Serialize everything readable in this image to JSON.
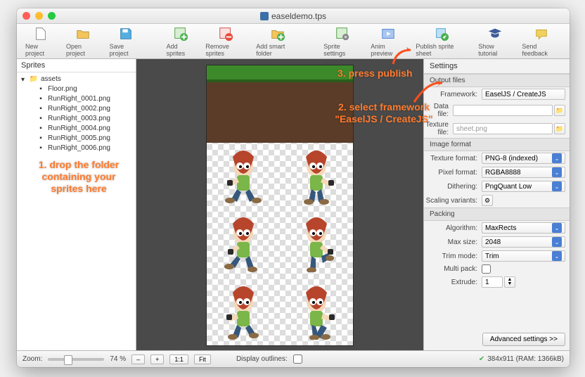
{
  "title": "easeldemo.tps",
  "toolbar": {
    "new": "New project",
    "open": "Open project",
    "save": "Save project",
    "addsprites": "Add sprites",
    "removesprites": "Remove sprites",
    "addsmart": "Add smart folder",
    "spritesettings": "Sprite settings",
    "animpreview": "Anim preview",
    "publish": "Publish sprite sheet",
    "tutorial": "Show tutorial",
    "feedback": "Send feedback"
  },
  "sidebar": {
    "heading": "Sprites",
    "folder": "assets",
    "files": [
      "Floor.png",
      "RunRight_0001.png",
      "RunRight_0002.png",
      "RunRight_0003.png",
      "RunRight_0004.png",
      "RunRight_0005.png",
      "RunRight_0006.png"
    ]
  },
  "props": {
    "heading": "Settings",
    "output": {
      "section": "Output files",
      "framework_label": "Framework:",
      "framework_value": "EaselJS / CreateJS",
      "datafile_label": "Data file:",
      "datafile_value": "",
      "texturefile_label": "Texture file:",
      "texturefile_value": "sheet.png"
    },
    "image": {
      "section": "Image format",
      "texfmt_label": "Texture format:",
      "texfmt_value": "PNG-8 (indexed)",
      "pixfmt_label": "Pixel format:",
      "pixfmt_value": "RGBA8888",
      "dither_label": "Dithering:",
      "dither_value": "PngQuant Low",
      "scale_label": "Scaling variants:"
    },
    "packing": {
      "section": "Packing",
      "algo_label": "Algorithm:",
      "algo_value": "MaxRects",
      "max_label": "Max size:",
      "max_value": "2048",
      "trim_label": "Trim mode:",
      "trim_value": "Trim",
      "multi_label": "Multi pack:",
      "extrude_label": "Extrude:",
      "extrude_value": "1"
    },
    "advanced": "Advanced settings >>"
  },
  "status": {
    "zoom_label": "Zoom:",
    "zoom_pct": "74 %",
    "minus": "‒",
    "plus": "+",
    "oneone": "1:1",
    "fit": "Fit",
    "outlines": "Display outlines:",
    "info": "384x911 (RAM: 1366kB)"
  },
  "annotations": {
    "a1": "1. drop the folder containing your sprites here",
    "a2": "2. select framework \"EaselJS / CreateJS\"",
    "a3": "3. press publish"
  }
}
